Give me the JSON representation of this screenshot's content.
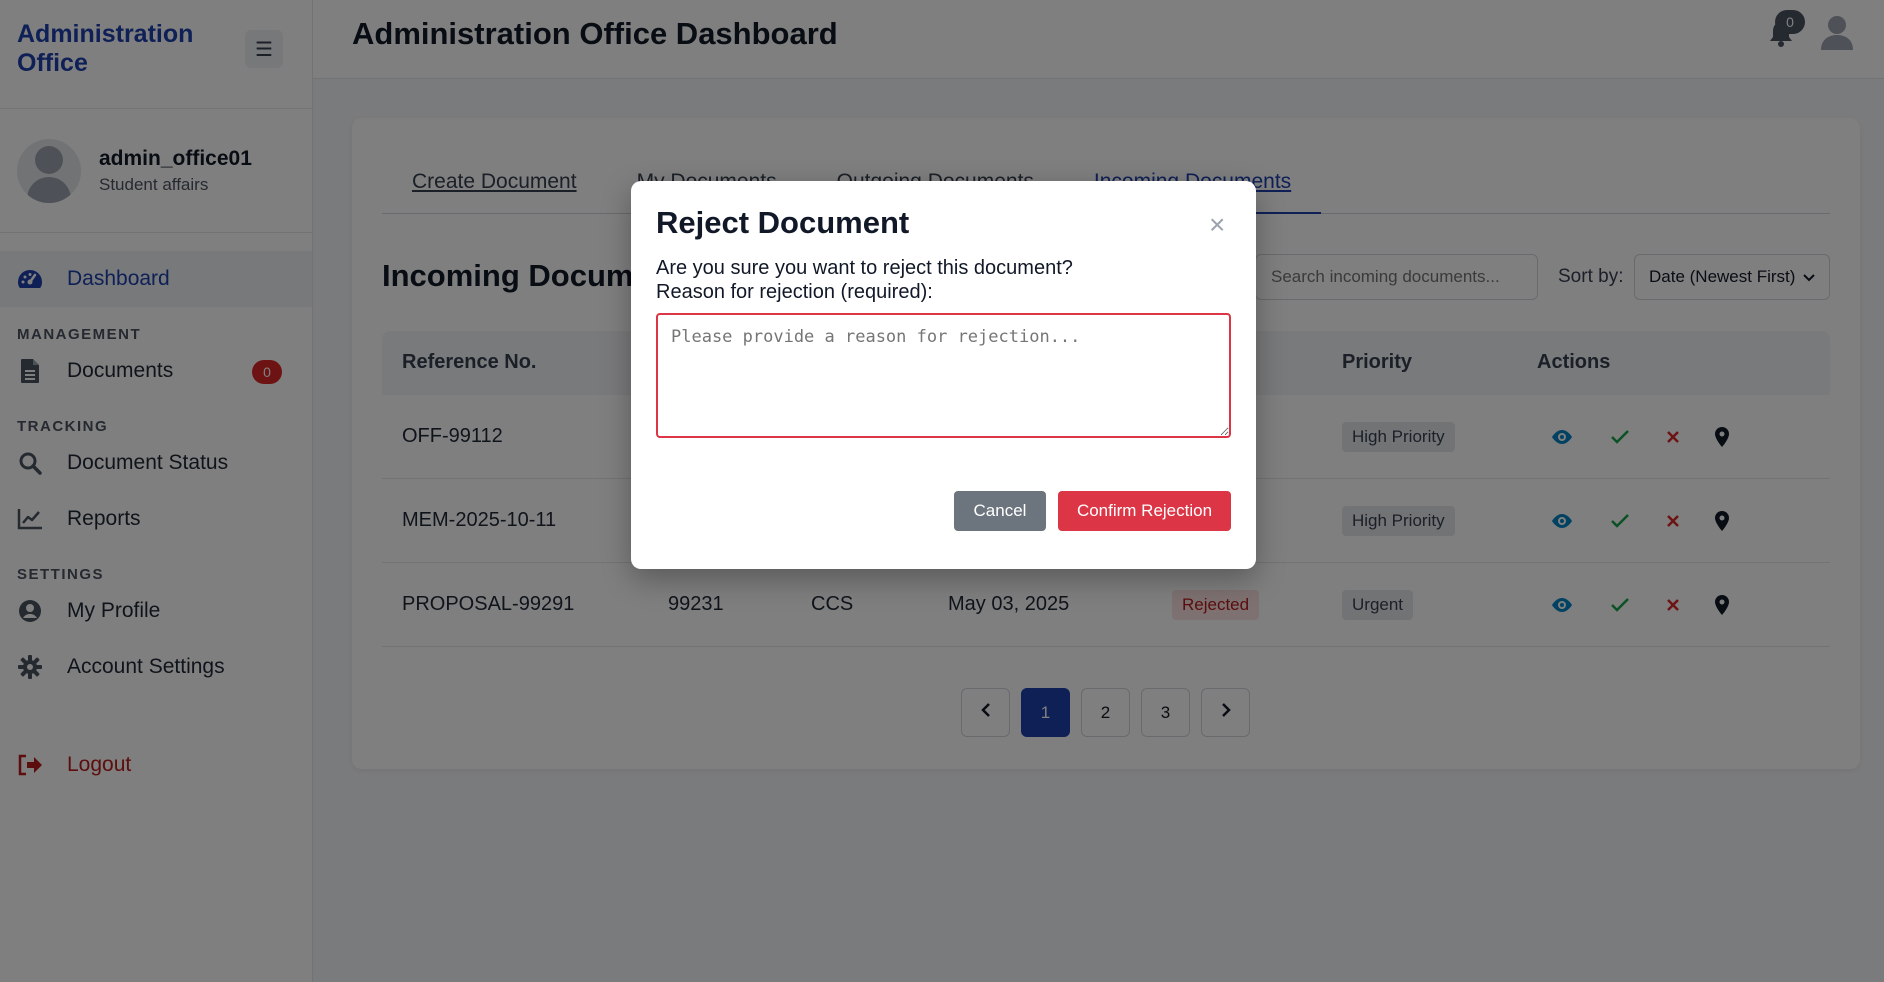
{
  "brand": {
    "title": "Administration Office",
    "menu_icon": "☰"
  },
  "user": {
    "name": "admin_office01",
    "role": "Student affairs"
  },
  "nav": {
    "dashboard": "Dashboard",
    "management_heading": "MANAGEMENT",
    "documents": "Documents",
    "documents_badge": "0",
    "tracking_heading": "TRACKING",
    "document_status": "Document Status",
    "reports": "Reports",
    "settings_heading": "SETTINGS",
    "my_profile": "My Profile",
    "account_settings": "Account Settings",
    "logout": "Logout"
  },
  "header": {
    "title": "Administration Office Dashboard",
    "notification_count": "0"
  },
  "tabs": [
    "Create Document",
    "My Documents",
    "Outgoing Documents",
    "Incoming Documents"
  ],
  "section": {
    "title": "Incoming Documents",
    "search_placeholder": "Search incoming documents...",
    "sort_label": "Sort by:",
    "sort_value": "Date (Newest First)"
  },
  "table": {
    "headers": {
      "ref": "Reference No.",
      "priority": "Priority",
      "actions": "Actions"
    },
    "rows": [
      {
        "ref": "OFF-99112",
        "col2": "",
        "col3": "",
        "date": "",
        "status": "",
        "priority": "High Priority"
      },
      {
        "ref": "MEM-2025-10-11",
        "col2": "",
        "col3": "",
        "date": "",
        "status": "",
        "priority": "High Priority"
      },
      {
        "ref": "PROPOSAL-99291",
        "col2": "99231",
        "col3": "CCS",
        "date": "May 03, 2025",
        "status": "Rejected",
        "priority": "Urgent"
      }
    ]
  },
  "pagination": {
    "pages": [
      "1",
      "2",
      "3"
    ],
    "current": "1"
  },
  "modal": {
    "title": "Reject Document",
    "close": "×",
    "message": "Are you sure you want to reject this document?",
    "reason_label": "Reason for rejection (required):",
    "reason_placeholder": "Please provide a reason for rejection...",
    "cancel": "Cancel",
    "confirm": "Confirm Rejection"
  },
  "colors": {
    "accent": "#1e40af",
    "danger": "#dc3545",
    "secondary": "#6c757d"
  }
}
